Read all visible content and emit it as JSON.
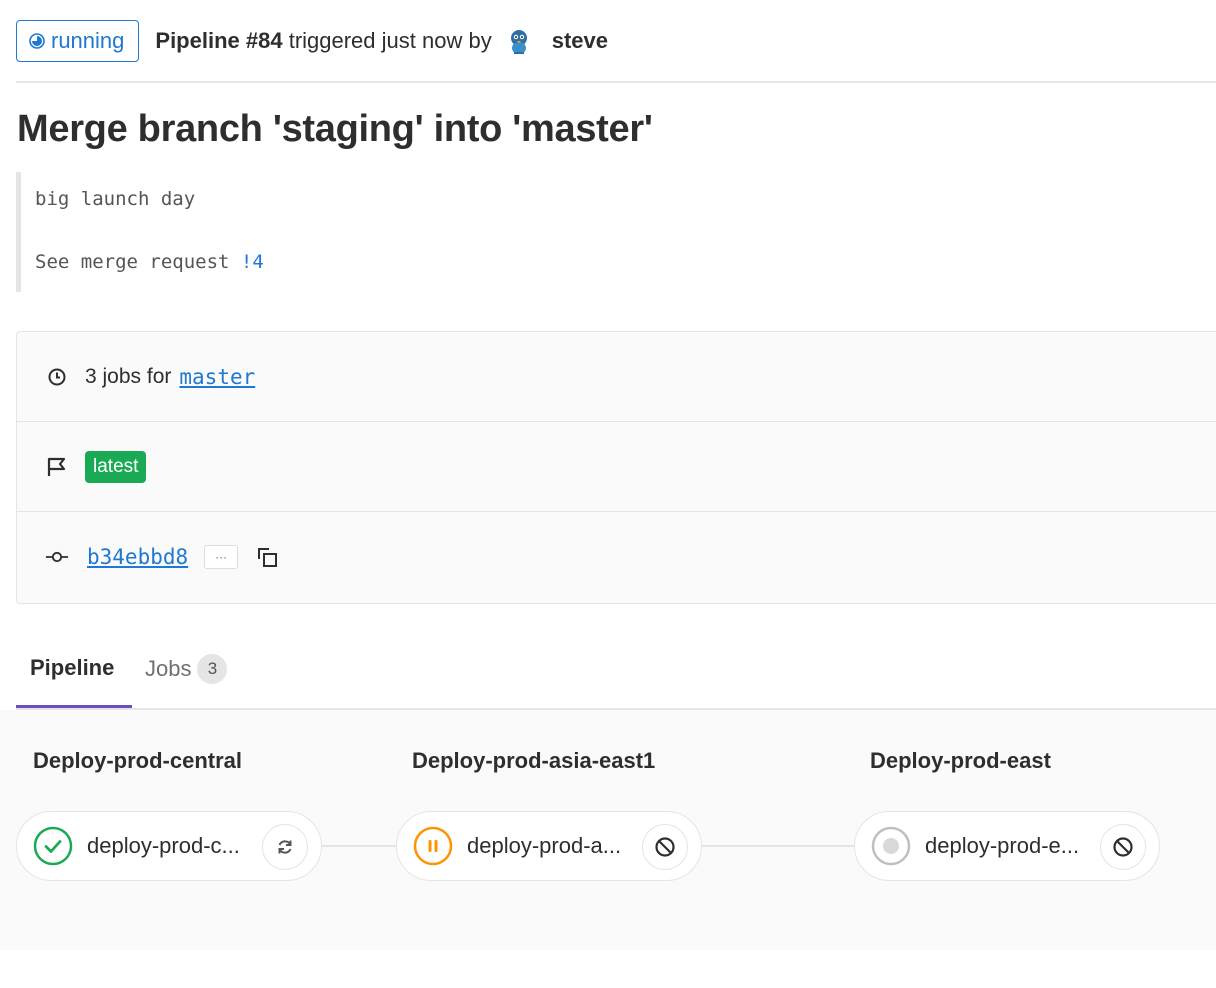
{
  "header": {
    "status": "running",
    "pipeline_label": "Pipeline #84",
    "triggered_text": "triggered just now by",
    "user": "steve"
  },
  "commit": {
    "title": "Merge branch 'staging' into 'master'",
    "description_line1": "big launch day",
    "description_line2_prefix": "See merge request ",
    "merge_request_link": "!4"
  },
  "info": {
    "jobs_text": "3 jobs for",
    "branch": "master",
    "badge": "latest",
    "sha": "b34ebbd8",
    "ellipsis": "···"
  },
  "tabs": {
    "pipeline": "Pipeline",
    "jobs": "Jobs",
    "jobs_count": "3"
  },
  "stages": [
    {
      "title": "Deploy-prod-central",
      "job": "deploy-prod-c...",
      "job_status": "success",
      "action": "retry"
    },
    {
      "title": "Deploy-prod-asia-east1",
      "job": "deploy-prod-a...",
      "job_status": "manual",
      "action": "cancel"
    },
    {
      "title": "Deploy-prod-east",
      "job": "deploy-prod-e...",
      "job_status": "created",
      "action": "cancel"
    }
  ],
  "colors": {
    "link": "#1f78d1",
    "success": "#1aaa55",
    "warning": "#fc9403",
    "tab_active": "#6b4fbb"
  }
}
